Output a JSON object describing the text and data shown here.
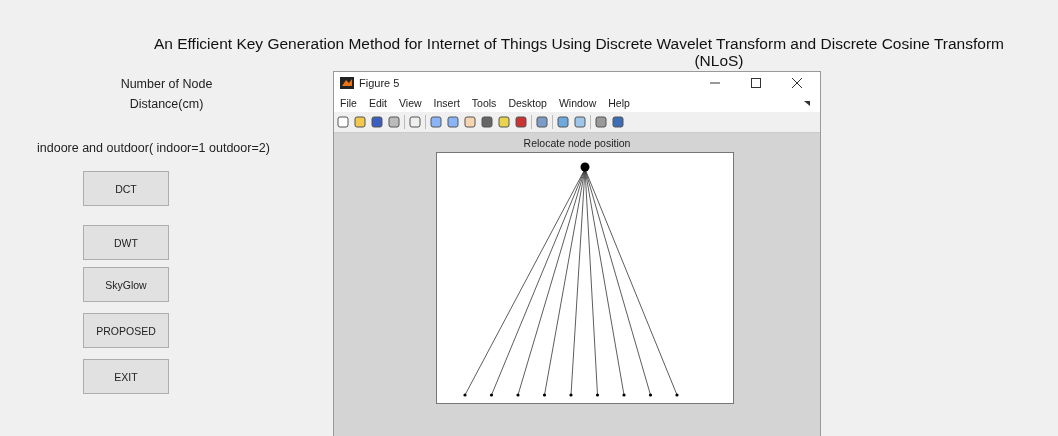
{
  "title_lines": [
    "An Efficient Key Generation Method for Internet of Things Using Discrete Wavelet Transform and Discrete Cosine Transform",
    "(NLoS)"
  ],
  "labels": [
    "Number of Node",
    "Distance(cm)",
    "indoore and outdoor( indoor=1 outdoor=2)"
  ],
  "buttons": [
    "DCT",
    "DWT",
    "SkyGlow",
    "PROPOSED",
    "EXIT"
  ],
  "figure_window": {
    "title": "Figure 5",
    "menu": [
      "File",
      "Edit",
      "View",
      "Insert",
      "Tools",
      "Desktop",
      "Window",
      "Help"
    ],
    "plot_title": "Relocate node position"
  }
}
